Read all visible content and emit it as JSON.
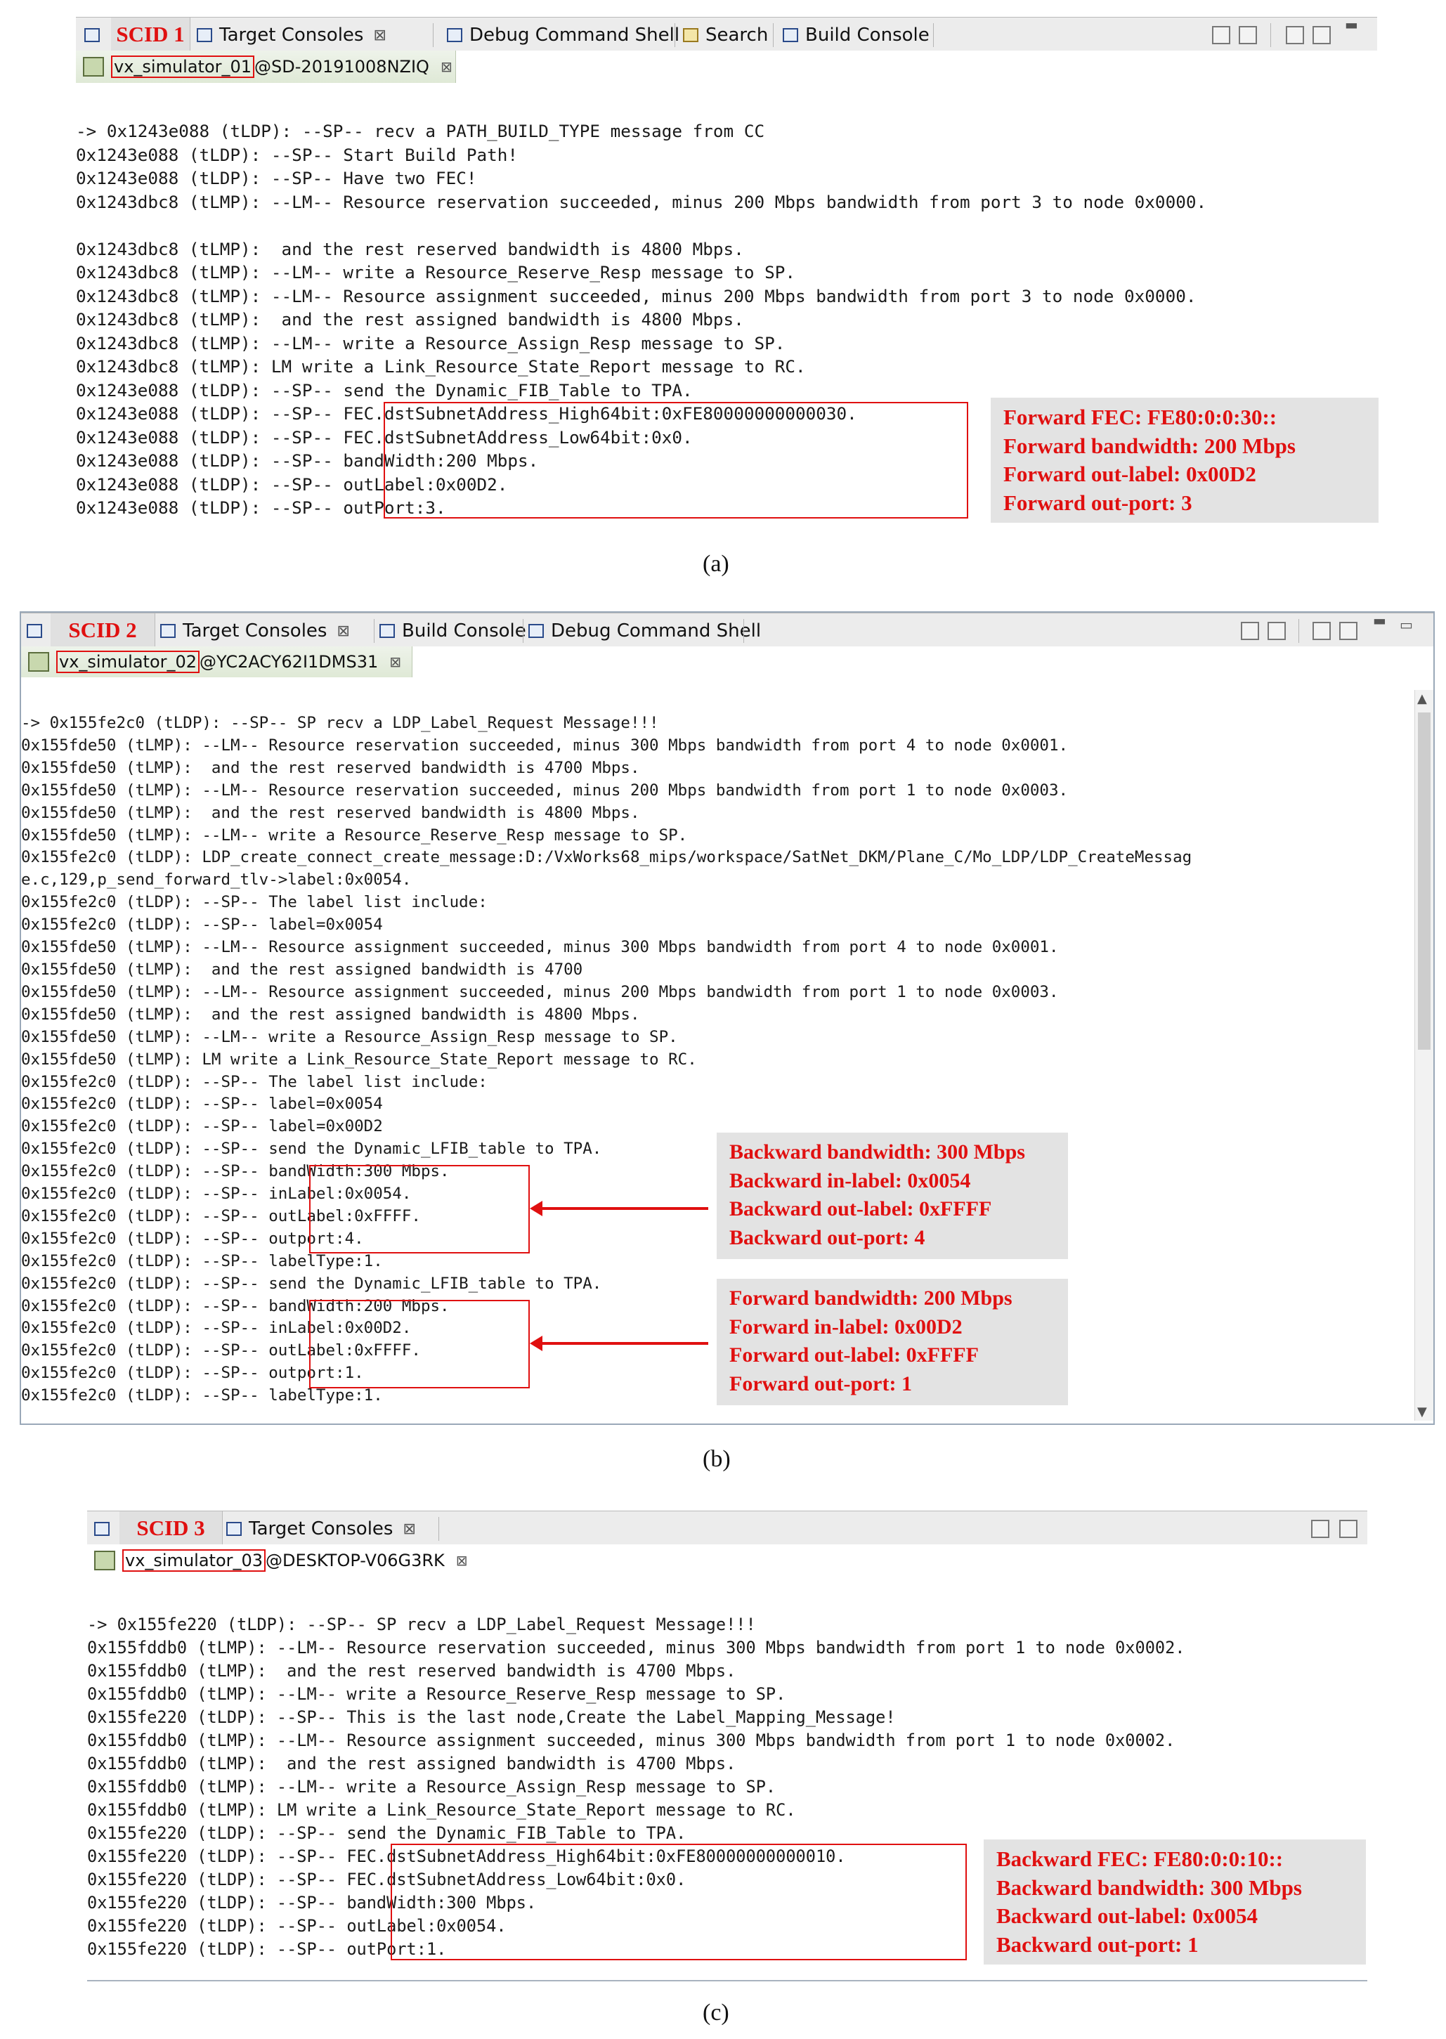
{
  "panel_a": {
    "scid": "SCID 1",
    "tabs": [
      "Target Consoles",
      "Debug Command Shell",
      "Search",
      "Build Console"
    ],
    "close_glyph": "⊠",
    "console_name": "vx_simulator_01",
    "console_host": "@SD-20191008NZIQ",
    "log": [
      "-> 0x1243e088 (tLDP): --SP-- recv a PATH_BUILD_TYPE message from CC",
      "0x1243e088 (tLDP): --SP-- Start Build Path!",
      "0x1243e088 (tLDP): --SP-- Have two FEC!",
      "0x1243dbc8 (tLMP): --LM-- Resource reservation succeeded, minus 200 Mbps bandwidth from port 3 to node 0x0000.",
      "",
      "0x1243dbc8 (tLMP):  and the rest reserved bandwidth is 4800 Mbps.",
      "0x1243dbc8 (tLMP): --LM-- write a Resource_Reserve_Resp message to SP.",
      "0x1243dbc8 (tLMP): --LM-- Resource assignment succeeded, minus 200 Mbps bandwidth from port 3 to node 0x0000.",
      "0x1243dbc8 (tLMP):  and the rest assigned bandwidth is 4800 Mbps.",
      "0x1243dbc8 (tLMP): --LM-- write a Resource_Assign_Resp message to SP.",
      "0x1243dbc8 (tLMP): LM write a Link_Resource_State_Report message to RC.",
      "0x1243e088 (tLDP): --SP-- send the Dynamic_FIB_Table to TPA.",
      "0x1243e088 (tLDP): --SP-- FEC.dstSubnetAddress_High64bit:0xFE80000000000030.",
      "0x1243e088 (tLDP): --SP-- FEC.dstSubnetAddress_Low64bit:0x0.",
      "0x1243e088 (tLDP): --SP-- bandWidth:200 Mbps.",
      "0x1243e088 (tLDP): --SP-- outLabel:0x00D2.",
      "0x1243e088 (tLDP): --SP-- outPort:3."
    ],
    "annotation": [
      "Forward FEC: FE80:0:0:30::",
      "Forward bandwidth: 200 Mbps",
      "Forward out-label: 0x00D2",
      "Forward out-port: 3"
    ],
    "caption": "(a)"
  },
  "panel_b": {
    "scid": "SCID 2",
    "tabs": [
      "Target Consoles",
      "Build Console",
      "Debug Command Shell"
    ],
    "close_glyph": "⊠",
    "console_name": "vx_simulator_02",
    "console_host": "@YC2ACY62I1DMS31",
    "log": [
      "-> 0x155fe2c0 (tLDP): --SP-- SP recv a LDP_Label_Request Message!!!",
      "0x155fde50 (tLMP): --LM-- Resource reservation succeeded, minus 300 Mbps bandwidth from port 4 to node 0x0001.",
      "0x155fde50 (tLMP):  and the rest reserved bandwidth is 4700 Mbps.",
      "0x155fde50 (tLMP): --LM-- Resource reservation succeeded, minus 200 Mbps bandwidth from port 1 to node 0x0003.",
      "0x155fde50 (tLMP):  and the rest reserved bandwidth is 4800 Mbps.",
      "0x155fde50 (tLMP): --LM-- write a Resource_Reserve_Resp message to SP.",
      "0x155fe2c0 (tLDP): LDP_create_connect_create_message:D:/VxWorks68_mips/workspace/SatNet_DKM/Plane_C/Mo_LDP/LDP_CreateMessag",
      "e.c,129,p_send_forward_tlv->label:0x0054.",
      "0x155fe2c0 (tLDP): --SP-- The label list include:",
      "0x155fe2c0 (tLDP): --SP-- label=0x0054",
      "0x155fde50 (tLMP): --LM-- Resource assignment succeeded, minus 300 Mbps bandwidth from port 4 to node 0x0001.",
      "0x155fde50 (tLMP):  and the rest assigned bandwidth is 4700",
      "0x155fde50 (tLMP): --LM-- Resource assignment succeeded, minus 200 Mbps bandwidth from port 1 to node 0x0003.",
      "0x155fde50 (tLMP):  and the rest assigned bandwidth is 4800 Mbps.",
      "0x155fde50 (tLMP): --LM-- write a Resource_Assign_Resp message to SP.",
      "0x155fde50 (tLMP): LM write a Link_Resource_State_Report message to RC.",
      "0x155fe2c0 (tLDP): --SP-- The label list include:",
      "0x155fe2c0 (tLDP): --SP-- label=0x0054",
      "0x155fe2c0 (tLDP): --SP-- label=0x00D2",
      "0x155fe2c0 (tLDP): --SP-- send the Dynamic_LFIB_table to TPA.",
      "0x155fe2c0 (tLDP): --SP-- bandWidth:300 Mbps.",
      "0x155fe2c0 (tLDP): --SP-- inLabel:0x0054.",
      "0x155fe2c0 (tLDP): --SP-- outLabel:0xFFFF.",
      "0x155fe2c0 (tLDP): --SP-- outport:4.",
      "0x155fe2c0 (tLDP): --SP-- labelType:1.",
      "0x155fe2c0 (tLDP): --SP-- send the Dynamic_LFIB_table to TPA.",
      "0x155fe2c0 (tLDP): --SP-- bandWidth:200 Mbps.",
      "0x155fe2c0 (tLDP): --SP-- inLabel:0x00D2.",
      "0x155fe2c0 (tLDP): --SP-- outLabel:0xFFFF.",
      "0x155fe2c0 (tLDP): --SP-- outport:1.",
      "0x155fe2c0 (tLDP): --SP-- labelType:1."
    ],
    "annotation_backward": [
      "Backward bandwidth:  300 Mbps",
      "Backward in-label: 0x0054",
      "Backward out-label: 0xFFFF",
      "Backward out-port: 4"
    ],
    "annotation_forward": [
      "Forward bandwidth: 200 Mbps",
      "Forward in-label: 0x00D2",
      "Forward out-label: 0xFFFF",
      "Forward out-port: 1"
    ],
    "caption": "(b)"
  },
  "panel_c": {
    "scid": "SCID 3",
    "tabs": [
      "Target Consoles"
    ],
    "close_glyph": "⊠",
    "console_name": "vx_simulator_03",
    "console_host": "@DESKTOP-V06G3RK",
    "log": [
      "-> 0x155fe220 (tLDP): --SP-- SP recv a LDP_Label_Request Message!!!",
      "0x155fddb0 (tLMP): --LM-- Resource reservation succeeded, minus 300 Mbps bandwidth from port 1 to node 0x0002.",
      "0x155fddb0 (tLMP):  and the rest reserved bandwidth is 4700 Mbps.",
      "0x155fddb0 (tLMP): --LM-- write a Resource_Reserve_Resp message to SP.",
      "0x155fe220 (tLDP): --SP-- This is the last node,Create the Label_Mapping_Message!",
      "0x155fddb0 (tLMP): --LM-- Resource assignment succeeded, minus 300 Mbps bandwidth from port 1 to node 0x0002.",
      "0x155fddb0 (tLMP):  and the rest assigned bandwidth is 4700 Mbps.",
      "0x155fddb0 (tLMP): --LM-- write a Resource_Assign_Resp message to SP.",
      "0x155fddb0 (tLMP): LM write a Link_Resource_State_Report message to RC.",
      "0x155fe220 (tLDP): --SP-- send the Dynamic_FIB_Table to TPA.",
      "0x155fe220 (tLDP): --SP-- FEC.dstSubnetAddress_High64bit:0xFE80000000000010.",
      "0x155fe220 (tLDP): --SP-- FEC.dstSubnetAddress_Low64bit:0x0.",
      "0x155fe220 (tLDP): --SP-- bandWidth:300 Mbps.",
      "0x155fe220 (tLDP): --SP-- outLabel:0x0054.",
      "0x155fe220 (tLDP): --SP-- outPort:1."
    ],
    "annotation": [
      "Backward FEC: FE80:0:0:10::",
      "Backward bandwidth: 300 Mbps",
      "Backward out-label: 0x0054",
      "Backward out-port: 1"
    ],
    "caption": "(c)"
  },
  "colors": {
    "highlight_red": "#e01010",
    "note_bg": "#e3e3e3",
    "tab_bg": "#ececec"
  }
}
